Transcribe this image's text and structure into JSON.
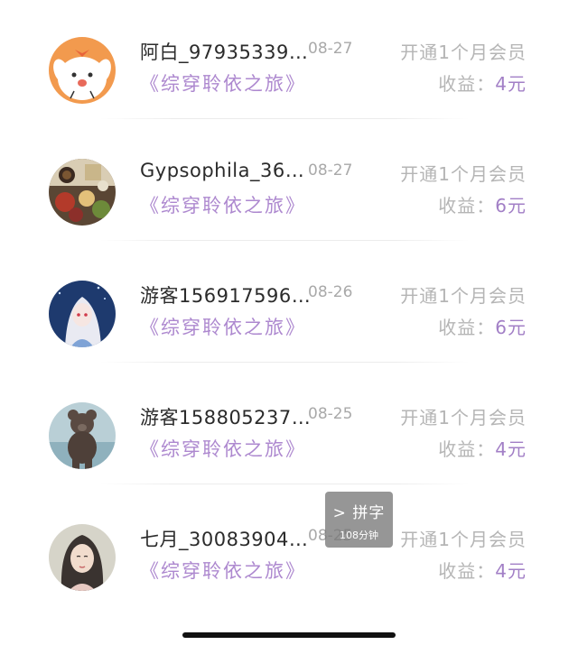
{
  "records": [
    {
      "name": "阿白_97935339…",
      "date": "08-27",
      "plan": "开通1个月会员",
      "book": "《综穿聆依之旅》",
      "earn_label": "收益：",
      "earn_amount": "4元",
      "avatar": "cartoon-dog-avatar"
    },
    {
      "name": "Gypsophila_36…",
      "date": "08-27",
      "plan": "开通1个月会员",
      "book": "《综穿聆依之旅》",
      "earn_label": "收益：",
      "earn_amount": "6元",
      "avatar": "food-photo-avatar"
    },
    {
      "name": "游客156917596…",
      "date": "08-26",
      "plan": "开通1个月会员",
      "book": "《综穿聆依之旅》",
      "earn_label": "收益：",
      "earn_amount": "6元",
      "avatar": "anime-girl-avatar"
    },
    {
      "name": "游客158805237…",
      "date": "08-25",
      "plan": "开通1个月会员",
      "book": "《综穿聆依之旅》",
      "earn_label": "收益：",
      "earn_amount": "4元",
      "avatar": "teddy-bear-avatar"
    },
    {
      "name": "七月_30083904…",
      "date": "08-25",
      "plan": "开通1个月会员",
      "book": "《综穿聆依之旅》",
      "earn_label": "收益：",
      "earn_amount": "4元",
      "avatar": "illustrated-girl-avatar"
    }
  ],
  "toast": {
    "title": "> 拼字",
    "subtitle": "108分钟"
  },
  "colors": {
    "accent": "#ad88cf",
    "muted": "#b5b5b5",
    "text": "#2b2b2b"
  }
}
